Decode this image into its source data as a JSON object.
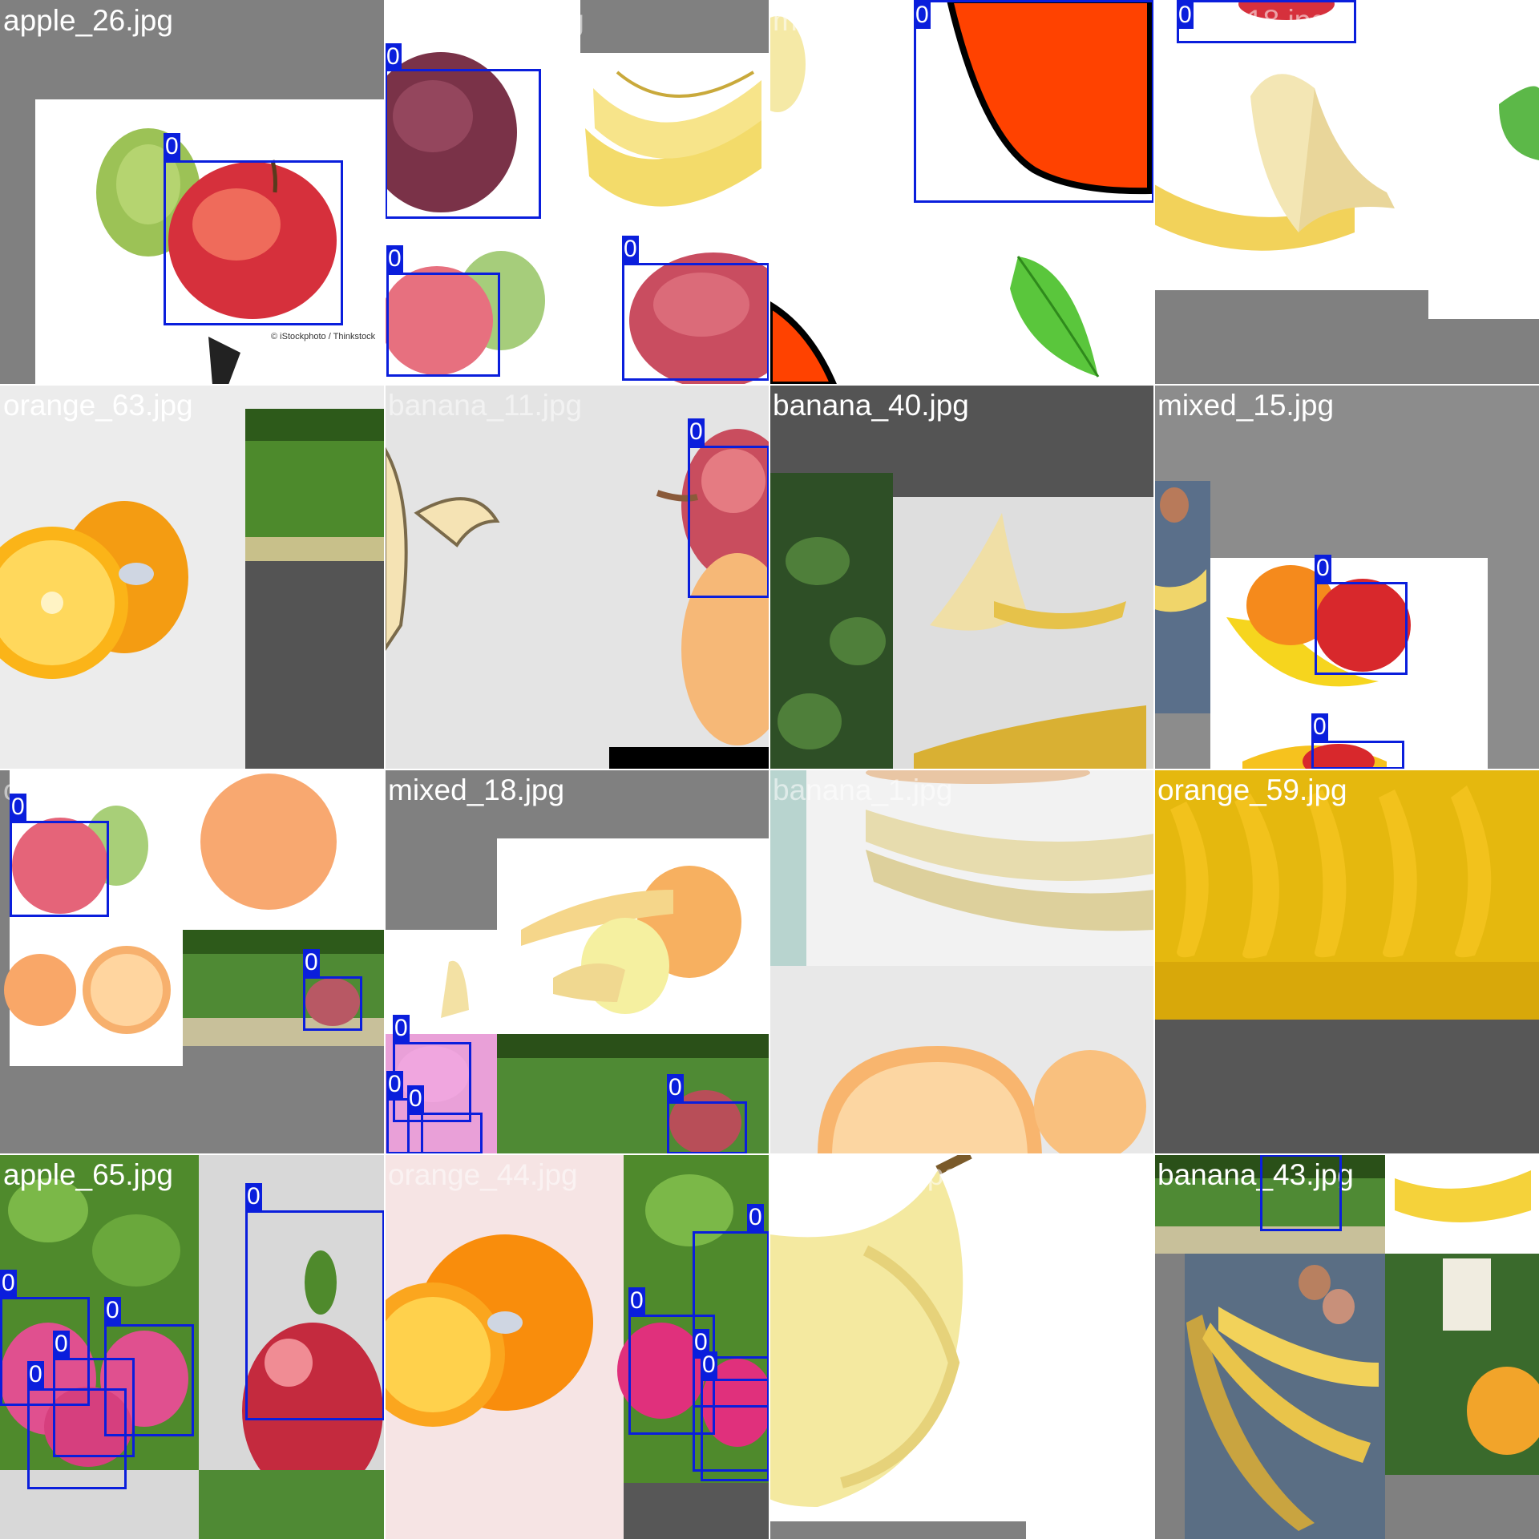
{
  "colors": {
    "box": "#0a1edc",
    "label_text": "#ffffff",
    "padding": "#808080"
  },
  "tiles": [
    {
      "filename": "apple_26.jpg",
      "scene": "apple-pair",
      "faint": false,
      "boxes": [
        {
          "label": "0"
        }
      ],
      "watermark": "© iStockphoto / Thinkstock"
    },
    {
      "filename": "banana_30.jpg",
      "scene": "apples-bananas",
      "faint": true,
      "boxes": [
        {
          "label": "0"
        },
        {
          "label": "0"
        },
        {
          "label": "0"
        }
      ]
    },
    {
      "filename": "mixed_11.jpg",
      "scene": "cartoon-red",
      "faint": true,
      "boxes": [
        {
          "label": "0"
        }
      ]
    },
    {
      "filename": "apple_18.jpg",
      "scene": "peeled-banana",
      "faint": true,
      "boxes": [
        {
          "label": "0"
        }
      ]
    },
    {
      "filename": "orange_63.jpg",
      "scene": "oranges-grass",
      "faint": false,
      "boxes": []
    },
    {
      "filename": "banana_11.jpg",
      "scene": "banana-outline",
      "faint": true,
      "boxes": [
        {
          "label": "0"
        }
      ]
    },
    {
      "filename": "banana_40.jpg",
      "scene": "bananas-tree",
      "faint": false,
      "boxes": []
    },
    {
      "filename": "mixed_15.jpg",
      "scene": "mixed-fruit",
      "faint": false,
      "boxes": [
        {
          "label": "0"
        },
        {
          "label": "0"
        }
      ]
    },
    {
      "filename": "orange_72.jpg",
      "scene": "oranges-apple",
      "faint": true,
      "boxes": [
        {
          "label": "0"
        },
        {
          "label": "0"
        }
      ]
    },
    {
      "filename": "mixed_18.jpg",
      "scene": "mixed-grass",
      "faint": false,
      "boxes": [
        {
          "label": "0"
        },
        {
          "label": "0"
        },
        {
          "label": "0"
        },
        {
          "label": "0"
        }
      ]
    },
    {
      "filename": "banana_1.jpg",
      "scene": "banana-orange",
      "faint": true,
      "boxes": []
    },
    {
      "filename": "orange_59.jpg",
      "scene": "yellow-bananas",
      "faint": false,
      "boxes": []
    },
    {
      "filename": "apple_65.jpg",
      "scene": "apple-tree",
      "faint": false,
      "boxes": [
        {
          "label": "0"
        },
        {
          "label": "0"
        },
        {
          "label": "0"
        },
        {
          "label": "0"
        },
        {
          "label": "0"
        }
      ]
    },
    {
      "filename": "orange_44.jpg",
      "scene": "orange-half",
      "faint": true,
      "boxes": [
        {
          "label": "0"
        },
        {
          "label": "0"
        },
        {
          "label": "0"
        },
        {
          "label": "0"
        }
      ]
    },
    {
      "filename": "orange_11.jpg",
      "scene": "single-banana",
      "faint": true,
      "boxes": []
    },
    {
      "filename": "banana_43.jpg",
      "scene": "banana-bunch",
      "faint": false,
      "boxes": [
        {
          "label": "0"
        }
      ]
    }
  ]
}
